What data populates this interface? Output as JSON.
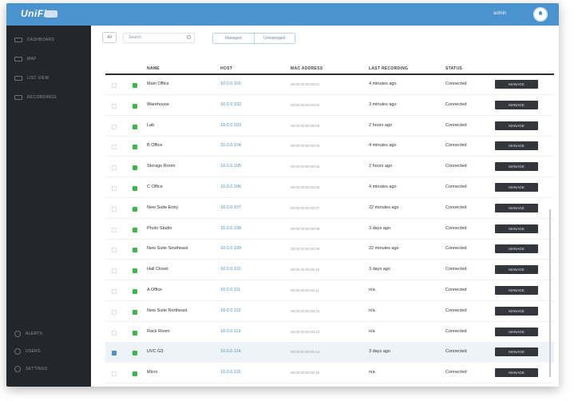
{
  "header": {
    "logo_text": "UniFi",
    "user_name": "admin"
  },
  "sidebar": {
    "items": [
      {
        "label": "Dashboard",
        "icon": "dashboard-icon"
      },
      {
        "label": "Map",
        "icon": "map-icon"
      },
      {
        "label": "List View",
        "icon": "list-icon"
      },
      {
        "label": "Recordings",
        "icon": "recordings-icon"
      }
    ],
    "bottom": [
      {
        "label": "Alerts",
        "icon": "bell-icon"
      },
      {
        "label": "Users",
        "icon": "users-icon"
      },
      {
        "label": "Settings",
        "icon": "gear-icon"
      }
    ]
  },
  "toolbar": {
    "all_label": "All",
    "search_placeholder": "Search",
    "seg_left": "Managed",
    "seg_right": "Unmanaged"
  },
  "table": {
    "columns": [
      "NAME",
      "HOST",
      "MAC ADDRESS",
      "LAST RECORDING",
      "STATUS"
    ],
    "manage_label": "MANAGE",
    "rows": [
      {
        "name": "Main Office",
        "host": "10.0.0.101",
        "mac": "00:00:00:00:00:01",
        "last": "4 minutes ago",
        "status": "Connected"
      },
      {
        "name": "Warehouse",
        "host": "10.0.0.102",
        "mac": "00:00:00:00:00:02",
        "last": "3 minutes ago",
        "status": "Connected"
      },
      {
        "name": "Lab",
        "host": "10.0.0.103",
        "mac": "00:00:00:00:00:03",
        "last": "2 hours ago",
        "status": "Connected"
      },
      {
        "name": "B Office",
        "host": "10.0.0.104",
        "mac": "00:00:00:00:00:04",
        "last": "4 minutes ago",
        "status": "Connected"
      },
      {
        "name": "Storage Room",
        "host": "10.0.0.105",
        "mac": "00:00:00:00:00:05",
        "last": "2 hours ago",
        "status": "Connected"
      },
      {
        "name": "C Office",
        "host": "10.0.0.106",
        "mac": "00:00:00:00:00:06",
        "last": "4 minutes ago",
        "status": "Connected"
      },
      {
        "name": "New Suite Entry",
        "host": "10.0.0.107",
        "mac": "00:00:00:00:00:07",
        "last": "22 minutes ago",
        "status": "Connected"
      },
      {
        "name": "Photo Studio",
        "host": "10.0.0.108",
        "mac": "00:00:00:00:00:08",
        "last": "3 days ago",
        "status": "Connected"
      },
      {
        "name": "New Suite Southeast",
        "host": "10.0.0.109",
        "mac": "00:00:00:00:00:09",
        "last": "22 minutes ago",
        "status": "Connected"
      },
      {
        "name": "Hall Closet",
        "host": "10.0.0.110",
        "mac": "00:00:00:00:00:10",
        "last": "3 days ago",
        "status": "Connected"
      },
      {
        "name": "A Office",
        "host": "10.0.0.111",
        "mac": "00:00:00:00:00:11",
        "last": "n/a",
        "status": "Connected"
      },
      {
        "name": "New Suite Northeast",
        "host": "10.0.0.112",
        "mac": "00:00:00:00:00:12",
        "last": "n/a",
        "status": "Connected"
      },
      {
        "name": "Rack Room",
        "host": "10.0.0.113",
        "mac": "00:00:00:00:00:13",
        "last": "n/a",
        "status": "Connected"
      },
      {
        "name": "UVC G3",
        "host": "10.0.0.114",
        "mac": "00:00:00:00:00:14",
        "last": "3 days ago",
        "status": "Connected"
      },
      {
        "name": "Micro",
        "host": "10.0.0.115",
        "mac": "00:00:00:00:00:15",
        "last": "n/a",
        "status": "Connected"
      }
    ]
  }
}
